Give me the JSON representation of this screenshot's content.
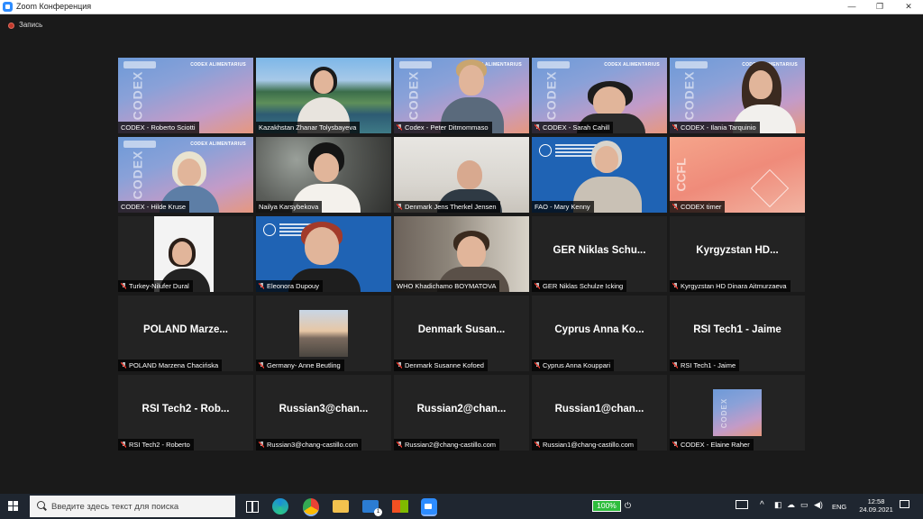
{
  "window": {
    "title": "Zoom Конференция",
    "minimize_glyph": "—",
    "maximize_glyph": "❐",
    "close_glyph": "✕"
  },
  "recording": {
    "label": "Запись",
    "color": "#c0392b"
  },
  "tiles": [
    {
      "name": "CODEX - Roberto Sciotti"
    },
    {
      "name": "Kazakhstan Zhanar Tolysbayeva"
    },
    {
      "name": "Codex - Peter Ditmommaso"
    },
    {
      "name": "CODEX - Sarah Cahill"
    },
    {
      "name": "CODEX - Ilania Tarquinio"
    },
    {
      "name": "CODEX - Hilde Kruse"
    },
    {
      "name": "Nailya Karsybekova"
    },
    {
      "name": "Denmark Jens Therkel Jensen"
    },
    {
      "name": "FAO - Mary Kenny"
    },
    {
      "name": "CODEX timer"
    },
    {
      "name": "Turkey-Nilufer Dural"
    },
    {
      "name": "Eleonora Dupouy"
    },
    {
      "name": "WHO Khadichamo BOYMATOVA"
    },
    {
      "name": "GER Niklas Schulze Icking",
      "display": "GER Niklas Schu..."
    },
    {
      "name": "Kyrgyzstan HD Dinara Aitmurzaeva",
      "display": "Kyrgyzstan HD..."
    },
    {
      "name": "POLAND Marzena Chacińska",
      "display": "POLAND Marze..."
    },
    {
      "name": "Germany- Anne Beutling"
    },
    {
      "name": "Denmark Susanne Kofoed",
      "display": "Denmark Susan..."
    },
    {
      "name": "Cyprus Anna Kouppari",
      "display": "Cyprus Anna Ko..."
    },
    {
      "name": "RSI Tech1 - Jaime",
      "display": "RSI Tech1 - Jaime"
    },
    {
      "name": "RSI Tech2 - Roberto",
      "display": "RSI Tech2 - Rob..."
    },
    {
      "name": "Russian3@chang-castillo.com",
      "display": "Russian3@chan..."
    },
    {
      "name": "Russian2@chang-castillo.com",
      "display": "Russian2@chan..."
    },
    {
      "name": "Russian1@chang-castillo.com",
      "display": "Russian1@chan..."
    },
    {
      "name": "CODEX - Elaine Raher"
    }
  ],
  "backgrounds": {
    "codex_brand": "CODEX ALIMENTARIUS",
    "codex_vertical": "CODEX",
    "cfl_vertical": "CCFL"
  },
  "taskbar": {
    "search_placeholder": "Введите здесь текст для поиска",
    "battery": "100%",
    "language": "ENG",
    "time": "12:58",
    "date": "24.09.2021",
    "notification_badge": "1"
  },
  "colors": {
    "active_speaker": "#c8de3b",
    "taskbar": "#1f2630",
    "battery": "#2ebd3d"
  }
}
